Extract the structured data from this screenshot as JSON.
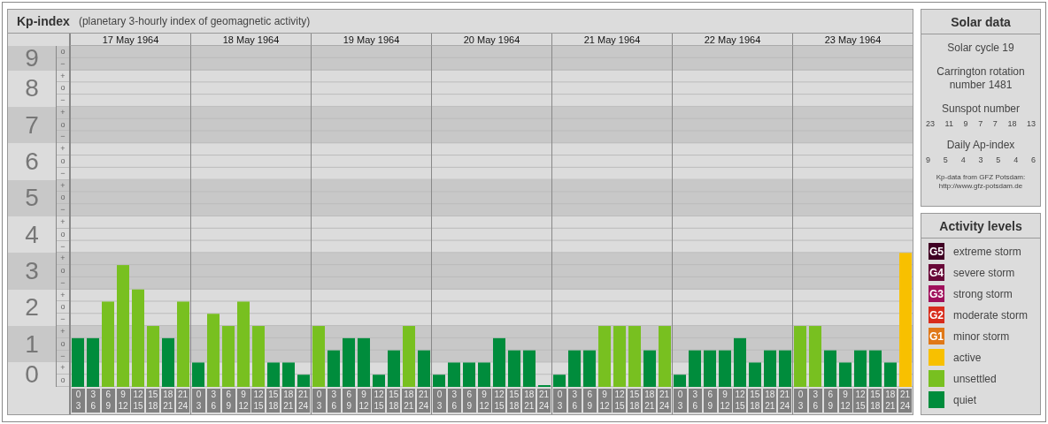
{
  "header": {
    "title": "Kp-index",
    "subtitle": "(planetary 3-hourly index of geomagnetic activity)"
  },
  "chart": {
    "y_sub_labels": [
      "o",
      "−",
      "+",
      "o",
      "−",
      "+",
      "o",
      "−",
      "+",
      "o",
      "−",
      "+",
      "o",
      "−",
      "+",
      "o",
      "−",
      "+",
      "o",
      "−",
      "+",
      "o",
      "−",
      "+",
      "o",
      "−",
      "+",
      "o"
    ],
    "days": [
      {
        "date": "17 May 1964",
        "slots": [
          {
            "from": "0",
            "to": "3"
          },
          {
            "from": "3",
            "to": "6"
          },
          {
            "from": "6",
            "to": "9"
          },
          {
            "from": "9",
            "to": "12"
          },
          {
            "from": "12",
            "to": "15"
          },
          {
            "from": "15",
            "to": "18"
          },
          {
            "from": "18",
            "to": "21"
          },
          {
            "from": "21",
            "to": "24"
          }
        ]
      },
      {
        "date": "18 May 1964",
        "slots": [
          {
            "from": "0",
            "to": "3"
          },
          {
            "from": "3",
            "to": "6"
          },
          {
            "from": "6",
            "to": "9"
          },
          {
            "from": "9",
            "to": "12"
          },
          {
            "from": "12",
            "to": "15"
          },
          {
            "from": "15",
            "to": "18"
          },
          {
            "from": "18",
            "to": "21"
          },
          {
            "from": "21",
            "to": "24"
          }
        ]
      },
      {
        "date": "19 May 1964",
        "slots": [
          {
            "from": "0",
            "to": "3"
          },
          {
            "from": "3",
            "to": "6"
          },
          {
            "from": "6",
            "to": "9"
          },
          {
            "from": "9",
            "to": "12"
          },
          {
            "from": "12",
            "to": "15"
          },
          {
            "from": "15",
            "to": "18"
          },
          {
            "from": "18",
            "to": "21"
          },
          {
            "from": "21",
            "to": "24"
          }
        ]
      },
      {
        "date": "20 May 1964",
        "slots": [
          {
            "from": "0",
            "to": "3"
          },
          {
            "from": "3",
            "to": "6"
          },
          {
            "from": "6",
            "to": "9"
          },
          {
            "from": "9",
            "to": "12"
          },
          {
            "from": "12",
            "to": "15"
          },
          {
            "from": "15",
            "to": "18"
          },
          {
            "from": "18",
            "to": "21"
          },
          {
            "from": "21",
            "to": "24"
          }
        ]
      },
      {
        "date": "21 May 1964",
        "slots": [
          {
            "from": "0",
            "to": "3"
          },
          {
            "from": "3",
            "to": "6"
          },
          {
            "from": "6",
            "to": "9"
          },
          {
            "from": "9",
            "to": "12"
          },
          {
            "from": "12",
            "to": "15"
          },
          {
            "from": "15",
            "to": "18"
          },
          {
            "from": "18",
            "to": "21"
          },
          {
            "from": "21",
            "to": "24"
          }
        ]
      },
      {
        "date": "22 May 1964",
        "slots": [
          {
            "from": "0",
            "to": "3"
          },
          {
            "from": "3",
            "to": "6"
          },
          {
            "from": "6",
            "to": "9"
          },
          {
            "from": "9",
            "to": "12"
          },
          {
            "from": "12",
            "to": "15"
          },
          {
            "from": "15",
            "to": "18"
          },
          {
            "from": "18",
            "to": "21"
          },
          {
            "from": "21",
            "to": "24"
          }
        ]
      },
      {
        "date": "23 May 1964",
        "slots": [
          {
            "from": "0",
            "to": "3"
          },
          {
            "from": "3",
            "to": "6"
          },
          {
            "from": "6",
            "to": "9"
          },
          {
            "from": "9",
            "to": "12"
          },
          {
            "from": "12",
            "to": "15"
          },
          {
            "from": "15",
            "to": "18"
          },
          {
            "from": "18",
            "to": "21"
          },
          {
            "from": "21",
            "to": "24"
          }
        ]
      }
    ],
    "chart_data": {
      "type": "bar",
      "ylim": [
        0,
        9.33
      ],
      "grid": true,
      "yticks": [
        {
          "value": 9,
          "label": "9"
        },
        {
          "value": 8,
          "label": "8"
        },
        {
          "value": 7,
          "label": "7"
        },
        {
          "value": 6,
          "label": "6"
        },
        {
          "value": 5,
          "label": "5"
        },
        {
          "value": 4,
          "label": "4"
        },
        {
          "value": 3,
          "label": "3"
        },
        {
          "value": 2,
          "label": "2"
        },
        {
          "value": 1,
          "label": "1"
        },
        {
          "value": 0,
          "label": "0"
        }
      ],
      "values": [
        1.33,
        1.33,
        2.33,
        3.33,
        2.67,
        1.67,
        1.33,
        2.33,
        0.67,
        2,
        1.67,
        2.33,
        1.67,
        0.67,
        0.67,
        0.33,
        1.67,
        1,
        1.33,
        1.33,
        0.33,
        1,
        1.67,
        1,
        0.33,
        0.67,
        0.67,
        0.67,
        1.33,
        1,
        1,
        0,
        0.33,
        1,
        1,
        1.67,
        1.67,
        1.67,
        1,
        1.67,
        0.33,
        1,
        1,
        1,
        1.33,
        0.67,
        1,
        1,
        1.67,
        1.67,
        1,
        0.67,
        1,
        1,
        0.67,
        3.67
      ]
    }
  },
  "solar": {
    "title": "Solar data",
    "cycle": "Solar cycle 19",
    "rotation": "Carrington rotation number 1481",
    "sunspot_label": "Sunspot number",
    "sunspots": [
      "23",
      "11",
      "9",
      "7",
      "7",
      "18",
      "13"
    ],
    "ap_label": "Daily Ap-index",
    "ap": [
      "9",
      "5",
      "4",
      "3",
      "5",
      "4",
      "6"
    ],
    "note": [
      "Kp-data from GFZ Potsdam:",
      "http://www.gfz-potsdam.de"
    ]
  },
  "legend": {
    "title": "Activity levels",
    "items": [
      {
        "badge": "G5",
        "label": "extreme storm",
        "color": "#400024"
      },
      {
        "badge": "G4",
        "label": "severe storm",
        "color": "#680838"
      },
      {
        "badge": "G3",
        "label": "strong storm",
        "color": "#a0105c"
      },
      {
        "badge": "G2",
        "label": "moderate storm",
        "color": "#d82c1c"
      },
      {
        "badge": "G1",
        "label": "minor storm",
        "color": "#e07818"
      },
      {
        "label": "active",
        "color": "#f8c000"
      },
      {
        "label": "unsettled",
        "color": "#78c020"
      },
      {
        "label": "quiet",
        "color": "#008c3c"
      }
    ]
  }
}
